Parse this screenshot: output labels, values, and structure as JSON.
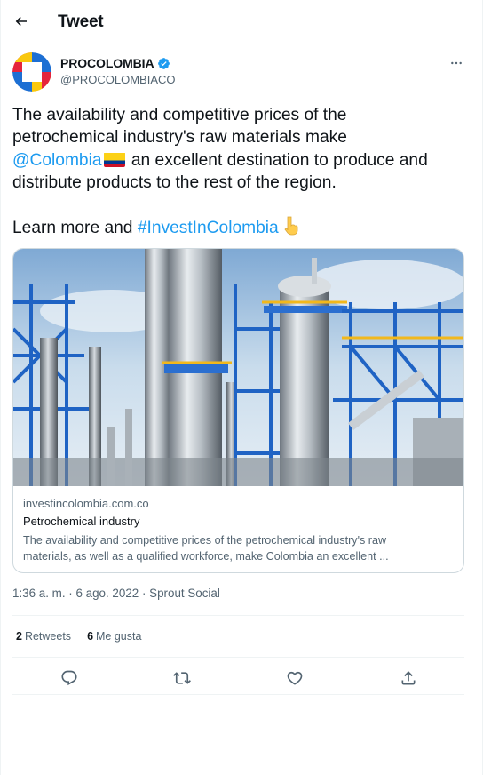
{
  "header": {
    "title": "Tweet"
  },
  "author": {
    "display_name": "PROCOLOMBIA",
    "handle": "@PROCOLOMBIACO",
    "verified": true
  },
  "tweet": {
    "line_1": "The availability and competitive prices of the",
    "line_2": "petrochemical industry's raw materials make",
    "mention": "@Colombia",
    "flag_emoji": "🇨🇴",
    "line_3_rest": "an excellent destination to produce and",
    "line_4": "distribute products to the rest of the region.",
    "learn_prefix": "Learn more and",
    "hashtag": "#InvestInColombia",
    "pointing_emoji": "👇"
  },
  "card": {
    "domain": "investincolombia.com.co",
    "title": "Petrochemical industry",
    "description_line_1": "The availability and competitive prices of the petrochemical industry's raw",
    "description_line_2": "materials, as well as a qualified workforce, make Colombia an excellent ..."
  },
  "meta": {
    "time": "1:36 a. m.",
    "separator": "·",
    "date": "6 ago. 2022",
    "source": "Sprout Social"
  },
  "stats": {
    "retweets_count": "2",
    "retweets_label": "Retweets",
    "likes_count": "6",
    "likes_label": "Me gusta"
  },
  "icons": {
    "back": "back-arrow-icon",
    "more": "more-icon",
    "verified": "verified-badge-icon",
    "reply": "reply-icon",
    "retweet": "retweet-icon",
    "like": "like-icon",
    "share": "share-icon"
  },
  "colors": {
    "accent": "#1d9bf0",
    "text": "#0f1419",
    "secondary_text": "#536471",
    "border": "#cfd9de"
  }
}
